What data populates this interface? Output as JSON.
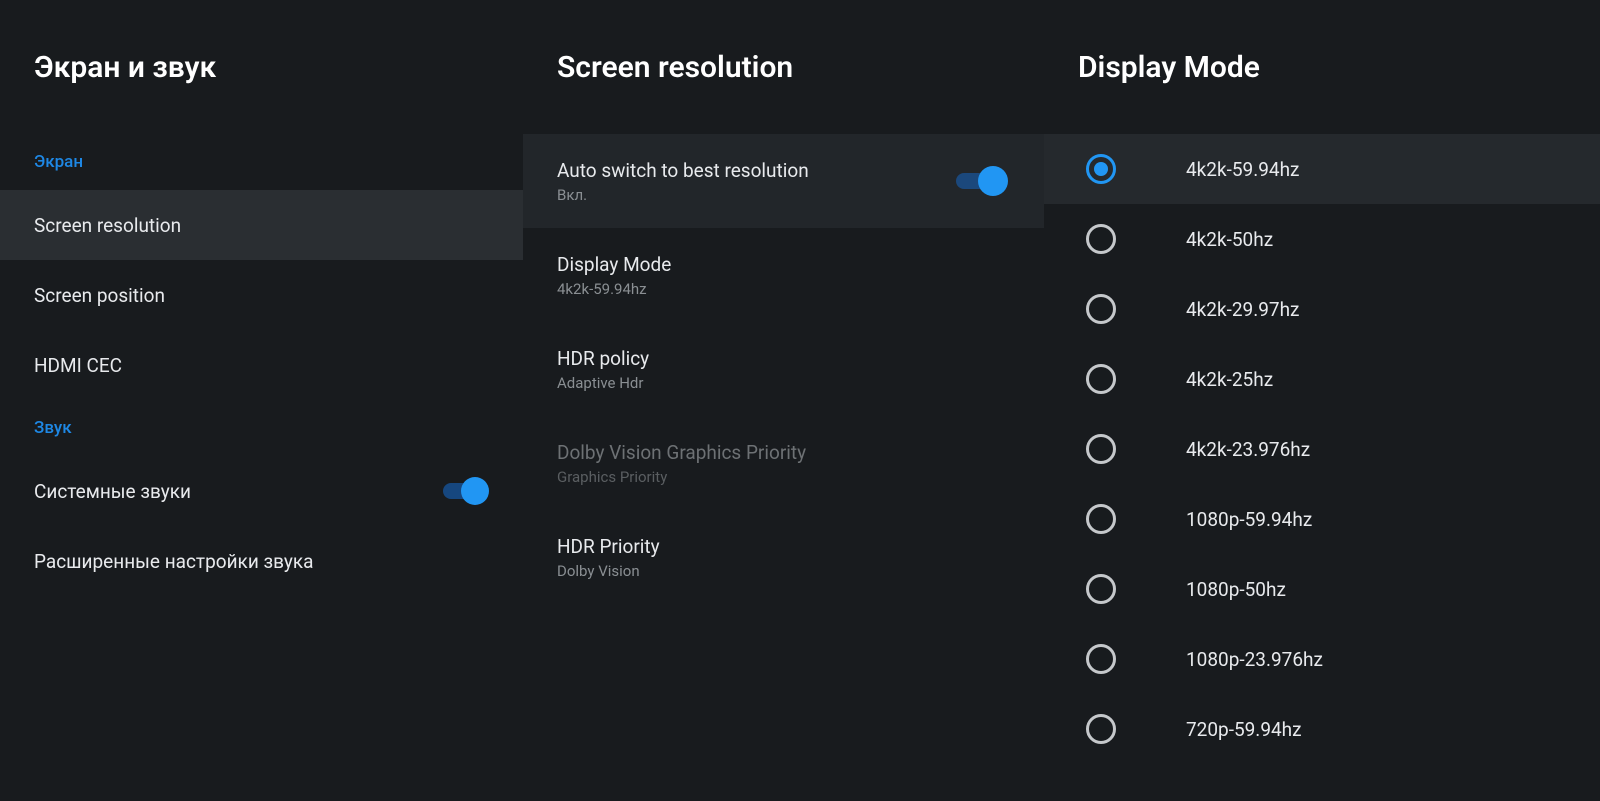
{
  "col1": {
    "title": "Экран и звук",
    "section1_label": "Экран",
    "items1": [
      {
        "label": "Screen resolution",
        "selected": true
      },
      {
        "label": "Screen position"
      },
      {
        "label": "HDMI CEC"
      }
    ],
    "section2_label": "Звук",
    "items2_toggle": {
      "label": "Системные звуки",
      "on": true
    },
    "items2_plain": {
      "label": "Расширенные настройки звука"
    }
  },
  "col2": {
    "title": "Screen resolution",
    "rows": [
      {
        "title": "Auto switch to best resolution",
        "sub": "Вкл.",
        "toggle": true,
        "highlight": true
      },
      {
        "title": "Display Mode",
        "sub": "4k2k-59.94hz"
      },
      {
        "title": "HDR policy",
        "sub": "Adaptive Hdr"
      },
      {
        "title": "Dolby Vision Graphics Priority",
        "sub": "Graphics Priority",
        "disabled": true
      },
      {
        "title": "HDR Priority",
        "sub": "Dolby Vision"
      }
    ]
  },
  "col3": {
    "title": "Display Mode",
    "options": [
      {
        "label": "4k2k-59.94hz",
        "checked": true,
        "selected": true
      },
      {
        "label": "4k2k-50hz"
      },
      {
        "label": "4k2k-29.97hz"
      },
      {
        "label": "4k2k-25hz"
      },
      {
        "label": "4k2k-23.976hz"
      },
      {
        "label": "1080p-59.94hz"
      },
      {
        "label": "1080p-50hz"
      },
      {
        "label": "1080p-23.976hz"
      },
      {
        "label": "720p-59.94hz"
      }
    ]
  }
}
